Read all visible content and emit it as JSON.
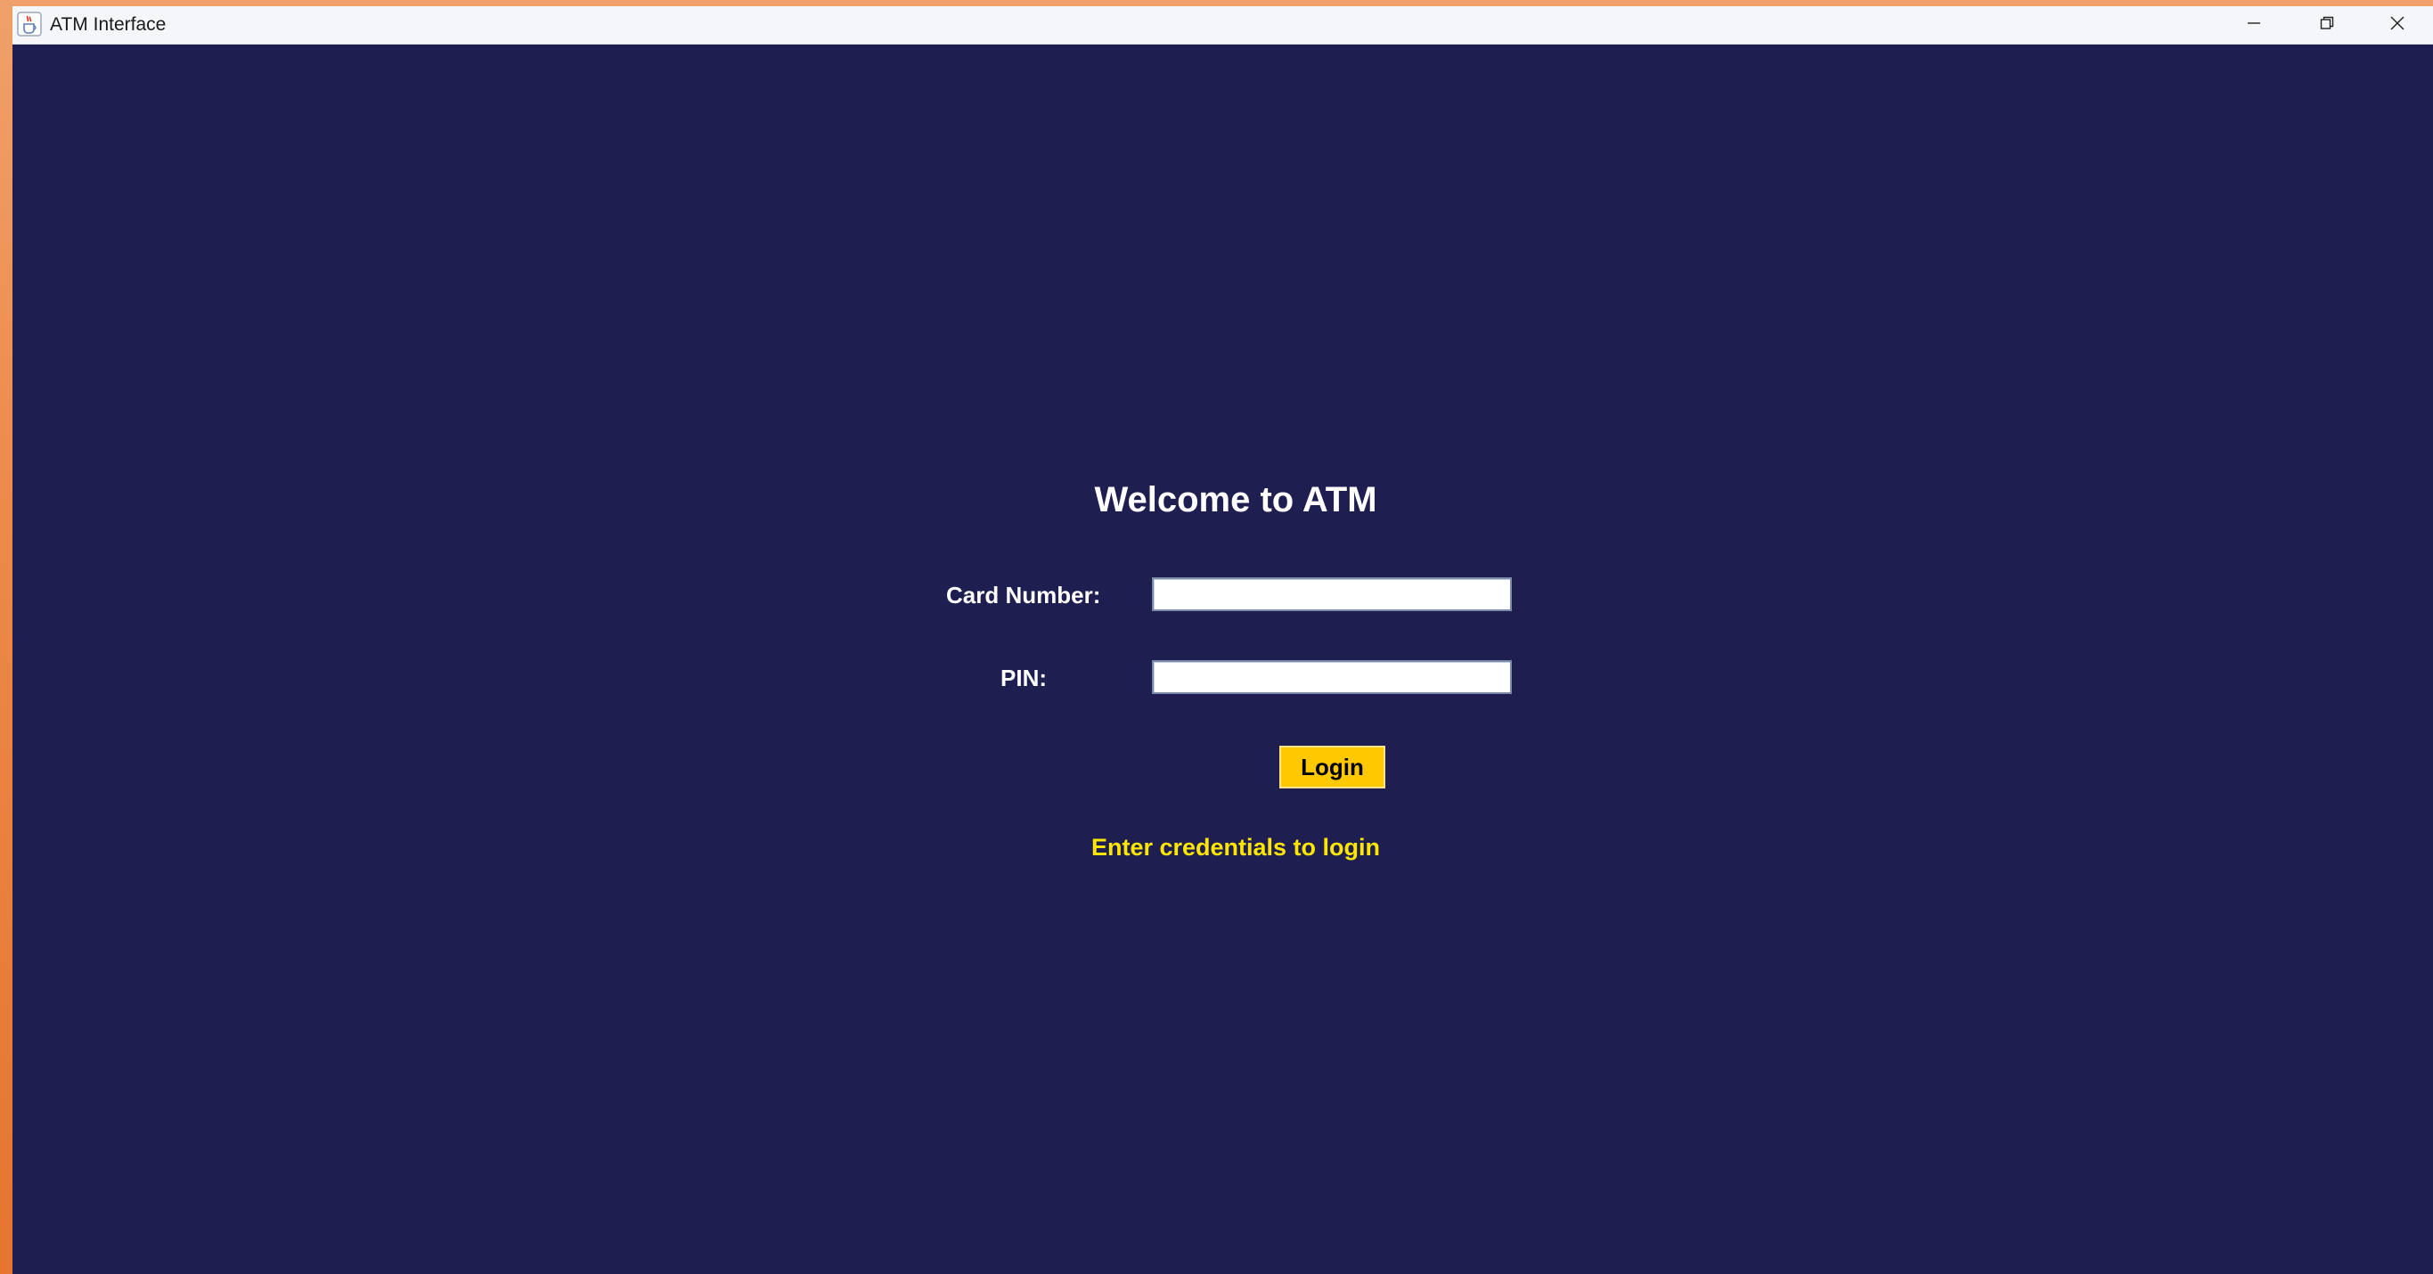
{
  "window": {
    "title": "ATM Interface",
    "app_icon": "java-coffee-cup-icon",
    "controls": {
      "minimize": "minimize-icon",
      "maximize": "restore-icon",
      "close": "close-icon"
    }
  },
  "login": {
    "heading": "Welcome to ATM",
    "card_label": "Card Number:",
    "card_value": "",
    "pin_label": "PIN:",
    "pin_value": "",
    "button_label": "Login",
    "status_message": "Enter credentials to login"
  },
  "colors": {
    "background": "#1e1e50",
    "button": "#ffc800",
    "status_text": "#ffe600",
    "label_text": "#ffffff"
  }
}
